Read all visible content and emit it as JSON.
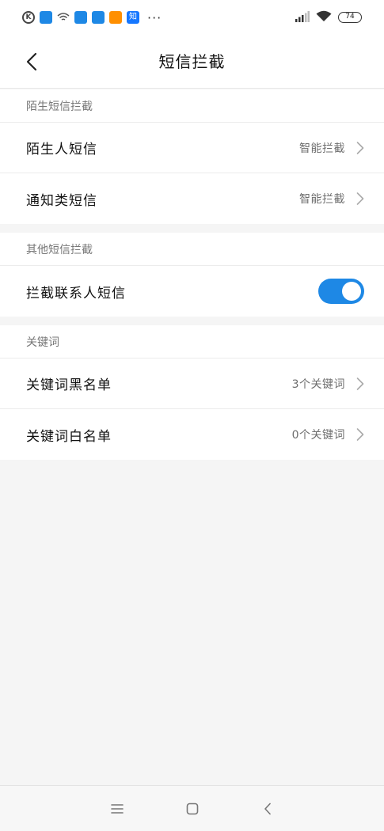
{
  "status_bar": {
    "battery": "74",
    "icons": [
      "k-icon",
      "app-icon",
      "wifi-small-icon",
      "app-icon",
      "app-icon",
      "orange-app-icon",
      "zhi-icon",
      "more-dots-icon"
    ],
    "zhi_label": "知",
    "k_label": "K",
    "more": "···"
  },
  "title_bar": {
    "title": "短信拦截"
  },
  "sections": [
    {
      "header": "陌生短信拦截",
      "rows": [
        {
          "label": "陌生人短信",
          "value": "智能拦截"
        },
        {
          "label": "通知类短信",
          "value": "智能拦截"
        }
      ]
    },
    {
      "header": "其他短信拦截",
      "rows": [
        {
          "label": "拦截联系人短信",
          "toggle": true
        }
      ]
    },
    {
      "header": "关键词",
      "rows": [
        {
          "label": "关键词黑名单",
          "value": "3个关键词"
        },
        {
          "label": "关键词白名单",
          "value": "0个关键词"
        }
      ]
    }
  ],
  "colors": {
    "accent": "#1e88e5",
    "background": "#f5f5f5",
    "card": "#ffffff"
  }
}
